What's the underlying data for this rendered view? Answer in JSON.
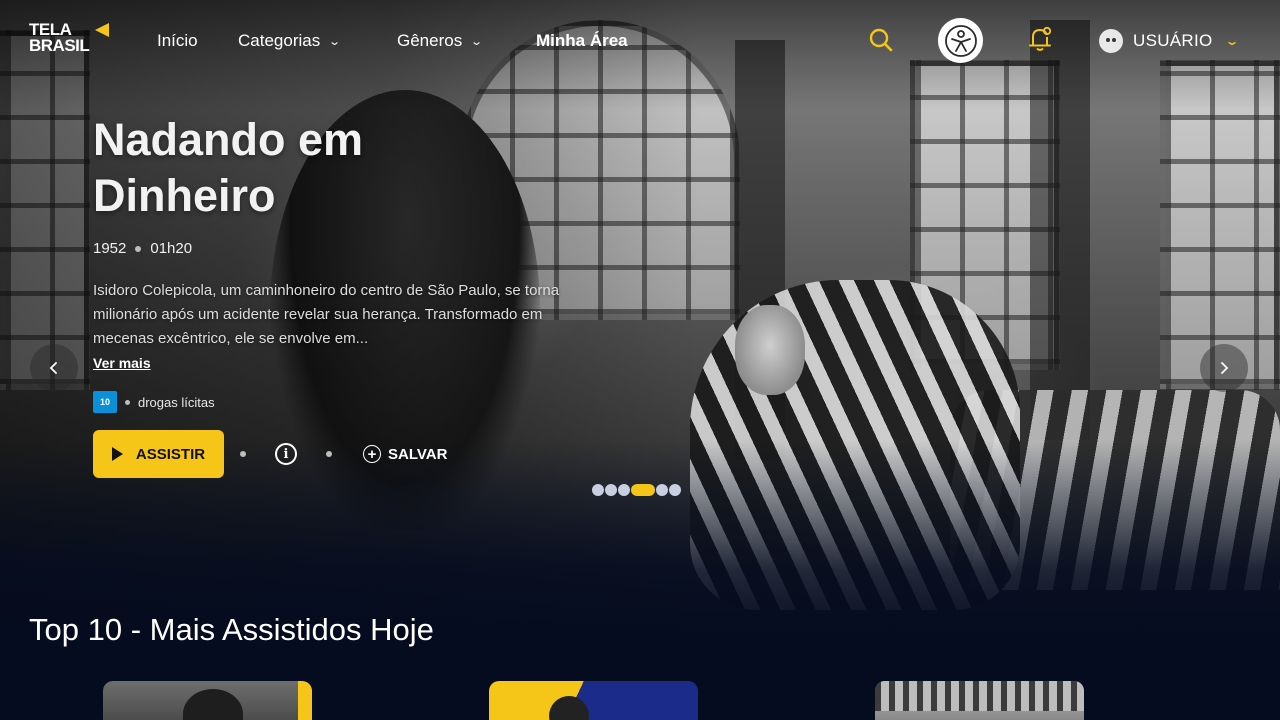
{
  "header": {
    "logo_line1": "TELA",
    "logo_line2": "BRASIL",
    "nav": {
      "inicio": "Início",
      "categorias": "Categorias",
      "generos": "Gêneros",
      "minha_area": "Minha Área"
    },
    "user_label": "USUÁRIO"
  },
  "hero": {
    "title": "Nadando em Dinheiro",
    "year": "1952",
    "duration": "01h20",
    "synopsis": "Isidoro Colepicola, um caminhoneiro do centro de São Paulo, se torna milionário após um acidente revelar sua herança. Transformado em mecenas excêntrico, ele se envolve em...",
    "see_more": "Ver mais",
    "rating": "10",
    "content_descriptor": "drogas lícitas",
    "watch_label": "ASSISTIR",
    "save_label": "SALVAR",
    "slides_total": 6,
    "slide_active_index": 3
  },
  "section": {
    "title": "Top 10 - Mais Assistidos Hoje"
  },
  "colors": {
    "accent": "#f5c518",
    "background": "#050c1f",
    "rating_badge": "#0a8fd9"
  },
  "icons": {
    "search": "search-icon",
    "accessibility": "accessibility-icon",
    "notification": "bell-icon",
    "avatar": "avatar",
    "chevron": "chevron-down-icon",
    "play": "play-icon",
    "info": "info-icon",
    "save": "plus-circle-icon",
    "prev": "chevron-left-icon",
    "next": "chevron-right-icon"
  }
}
